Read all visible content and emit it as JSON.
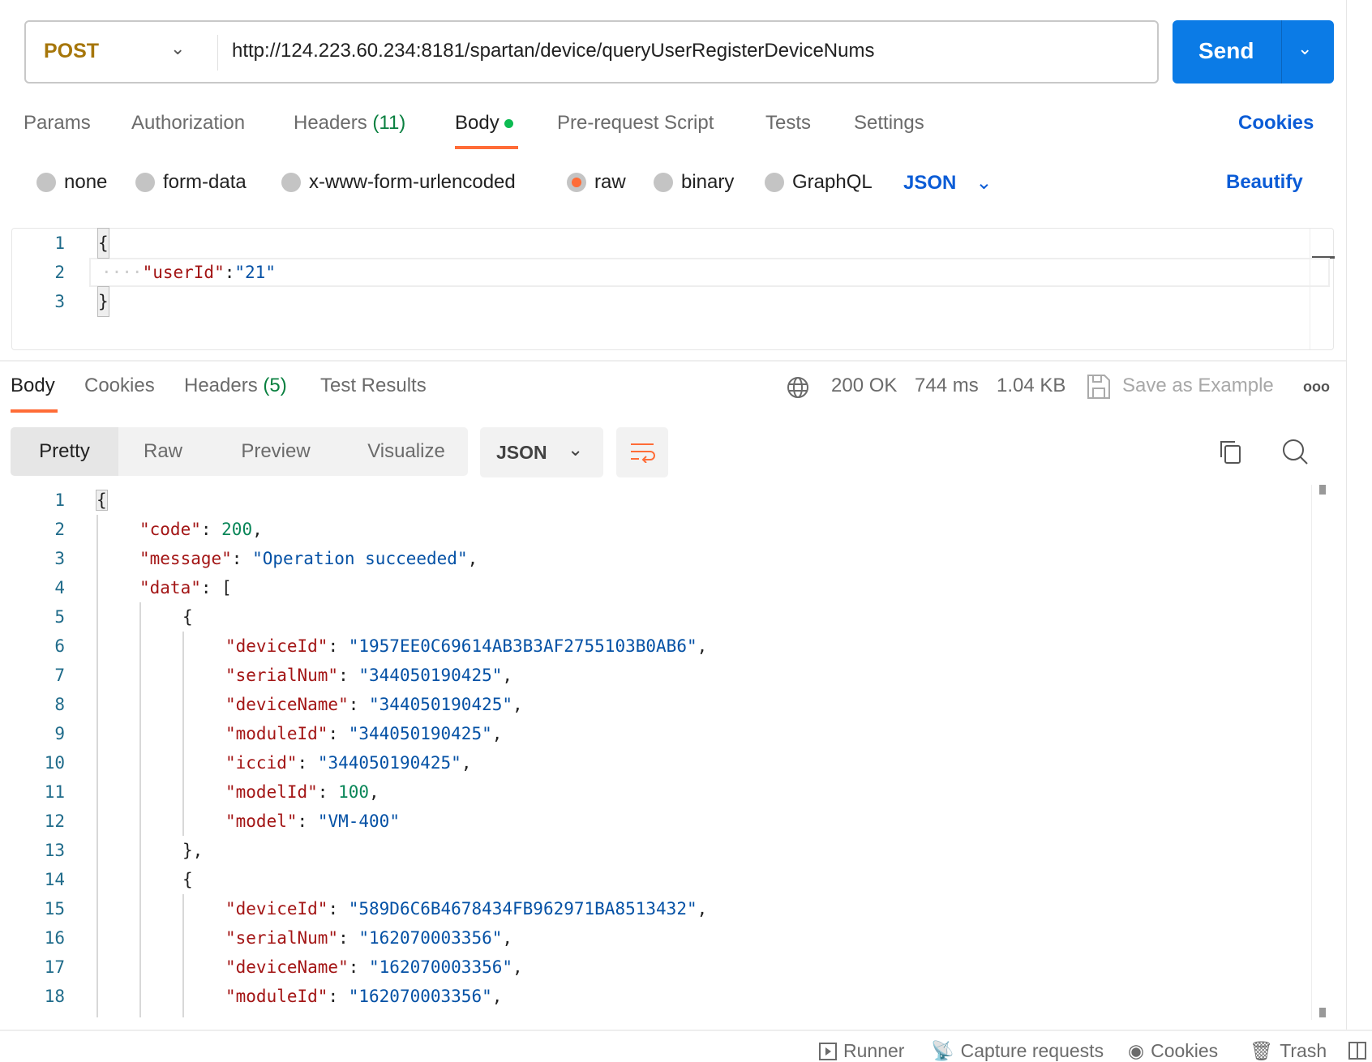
{
  "request": {
    "method": "POST",
    "url": "http://124.223.60.234:8181/spartan/device/queryUserRegisterDeviceNums",
    "send_label": "Send"
  },
  "req_tabs": [
    {
      "label": "Params"
    },
    {
      "label": "Authorization"
    },
    {
      "label": "Headers",
      "count": "(11)"
    },
    {
      "label": "Body"
    },
    {
      "label": "Pre-request Script"
    },
    {
      "label": "Tests"
    },
    {
      "label": "Settings"
    }
  ],
  "cookies_link": "Cookies",
  "body_types": [
    "none",
    "form-data",
    "x-www-form-urlencoded",
    "raw",
    "binary",
    "GraphQL"
  ],
  "selected_body_type": "raw",
  "raw_format": "JSON",
  "beautify": "Beautify",
  "request_body": [
    {
      "n": "1",
      "t": "{"
    },
    {
      "n": "2",
      "k": "\"userId\"",
      "v": "\"21\""
    },
    {
      "n": "3",
      "t": "}"
    }
  ],
  "resp_tabs": [
    {
      "label": "Body"
    },
    {
      "label": "Cookies"
    },
    {
      "label": "Headers",
      "count": "(5)"
    },
    {
      "label": "Test Results"
    }
  ],
  "status": {
    "code": "200 OK",
    "time": "744 ms",
    "size": "1.04 KB",
    "save": "Save as Example",
    "more": "ooo"
  },
  "view_modes": [
    "Pretty",
    "Raw",
    "Preview",
    "Visualize"
  ],
  "resp_format": "JSON",
  "response_lines": [
    {
      "n": "1",
      "i": 0,
      "t": "{"
    },
    {
      "n": "2",
      "i": 1,
      "k": "\"code\"",
      "v": "200",
      "vt": "n",
      "c": ","
    },
    {
      "n": "3",
      "i": 1,
      "k": "\"message\"",
      "v": "\"Operation succeeded\"",
      "vt": "s",
      "c": ","
    },
    {
      "n": "4",
      "i": 1,
      "k": "\"data\"",
      "t2": "["
    },
    {
      "n": "5",
      "i": 2,
      "t": "{"
    },
    {
      "n": "6",
      "i": 3,
      "k": "\"deviceId\"",
      "v": "\"1957EE0C69614AB3B3AF2755103B0AB6\"",
      "vt": "s",
      "c": ","
    },
    {
      "n": "7",
      "i": 3,
      "k": "\"serialNum\"",
      "v": "\"344050190425\"",
      "vt": "s",
      "c": ","
    },
    {
      "n": "8",
      "i": 3,
      "k": "\"deviceName\"",
      "v": "\"344050190425\"",
      "vt": "s",
      "c": ","
    },
    {
      "n": "9",
      "i": 3,
      "k": "\"moduleId\"",
      "v": "\"344050190425\"",
      "vt": "s",
      "c": ","
    },
    {
      "n": "10",
      "i": 3,
      "k": "\"iccid\"",
      "v": "\"344050190425\"",
      "vt": "s",
      "c": ","
    },
    {
      "n": "11",
      "i": 3,
      "k": "\"modelId\"",
      "v": "100",
      "vt": "n",
      "c": ","
    },
    {
      "n": "12",
      "i": 3,
      "k": "\"model\"",
      "v": "\"VM-400\"",
      "vt": "s",
      "c": ""
    },
    {
      "n": "13",
      "i": 2,
      "t": "},"
    },
    {
      "n": "14",
      "i": 2,
      "t": "{"
    },
    {
      "n": "15",
      "i": 3,
      "k": "\"deviceId\"",
      "v": "\"589D6C6B4678434FB962971BA8513432\"",
      "vt": "s",
      "c": ","
    },
    {
      "n": "16",
      "i": 3,
      "k": "\"serialNum\"",
      "v": "\"162070003356\"",
      "vt": "s",
      "c": ","
    },
    {
      "n": "17",
      "i": 3,
      "k": "\"deviceName\"",
      "v": "\"162070003356\"",
      "vt": "s",
      "c": ","
    },
    {
      "n": "18",
      "i": 3,
      "k": "\"moduleId\"",
      "v": "\"162070003356\"",
      "vt": "s",
      "c": ","
    }
  ],
  "footer": [
    "Runner",
    "Capture requests",
    "Cookies",
    "Trash"
  ],
  "colors": {
    "accent": "#ff6c37",
    "send": "#0b7be6",
    "method": "#a6760a",
    "status": "#0a8040"
  }
}
